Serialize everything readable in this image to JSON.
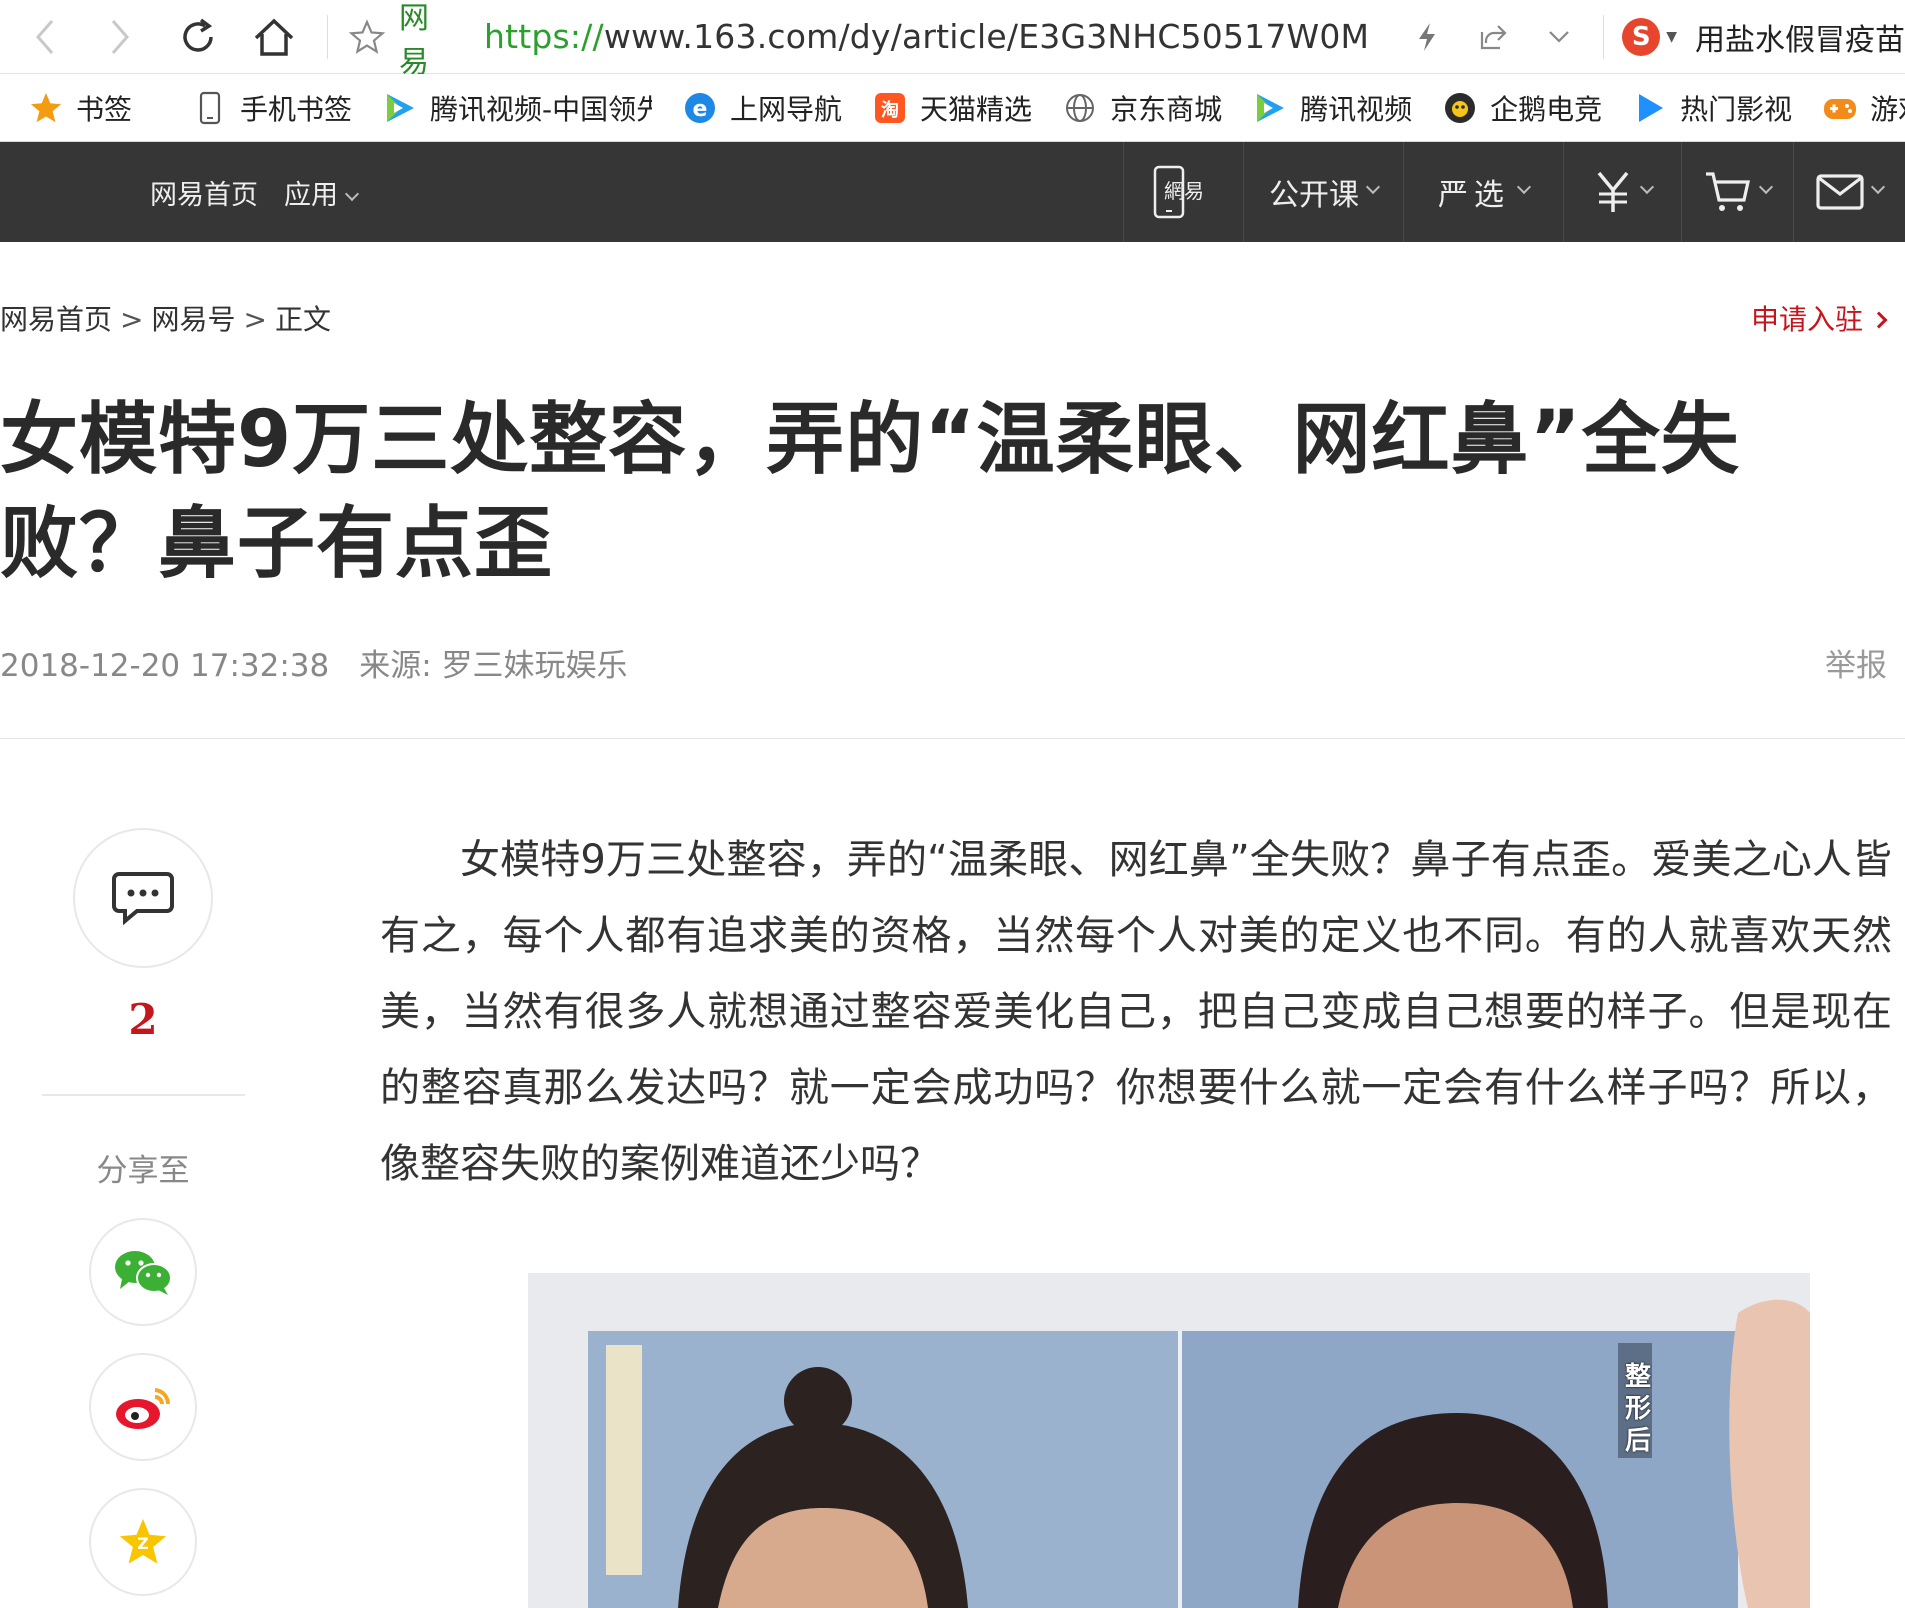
{
  "browser": {
    "site_name": "网易",
    "url_scheme": "https://",
    "url_rest": "www.163.com/dy/article/E3G3NHC50517W0M",
    "search_hint": "用盐水假冒疫苗"
  },
  "bookmarks": [
    {
      "label": "书签",
      "icon": "star-icon"
    },
    {
      "label": "手机书签",
      "icon": "phone-icon"
    },
    {
      "label": "腾讯视频-中国领先",
      "icon": "tencent-video-icon"
    },
    {
      "label": "上网导航",
      "icon": "ie-icon"
    },
    {
      "label": "天猫精选",
      "icon": "tmall-icon"
    },
    {
      "label": "京东商城",
      "icon": "globe-icon"
    },
    {
      "label": "腾讯视频",
      "icon": "tencent-video-icon"
    },
    {
      "label": "企鹅电竞",
      "icon": "penguin-esports-icon"
    },
    {
      "label": "热门影视",
      "icon": "play-icon"
    },
    {
      "label": "游戏中心",
      "icon": "gamepad-icon"
    }
  ],
  "site_nav": {
    "home": "网易首页",
    "apps": "应用",
    "open_course": "公开课",
    "yanxuan": "严选"
  },
  "breadcrumb": {
    "home": "网易首页",
    "sep": ">",
    "section": "网易号",
    "current": "正文"
  },
  "apply_label": "申请入驻",
  "article": {
    "title": "女模特9万三处整容，弄的“温柔眼、网红鼻”全失败？鼻子有点歪",
    "date": "2018-12-20 17:32:38",
    "source": "来源: 罗三妹玩娱乐",
    "report": "举报",
    "body": "女模特9万三处整容，弄的“温柔眼、网红鼻”全失败？鼻子有点歪。爱美之心人皆有之，每个人都有追求美的资格，当然每个人对美的定义也不同。有的人就喜欢天然美，当然有很多人就想通过整容爱美化自己，把自己变成自己想要的样子。但是现在的整容真那么发达吗？就一定会成功吗？你想要什么就一定会有什么样子吗？所以，像整容失败的案例难道还少吗？",
    "photo_caption": "整形后"
  },
  "sidebar": {
    "comment_count": "2",
    "share_label": "分享至"
  },
  "colors": {
    "accent_red": "#c4161c",
    "nav_bg": "#363636",
    "url_green": "#2ca02c"
  }
}
